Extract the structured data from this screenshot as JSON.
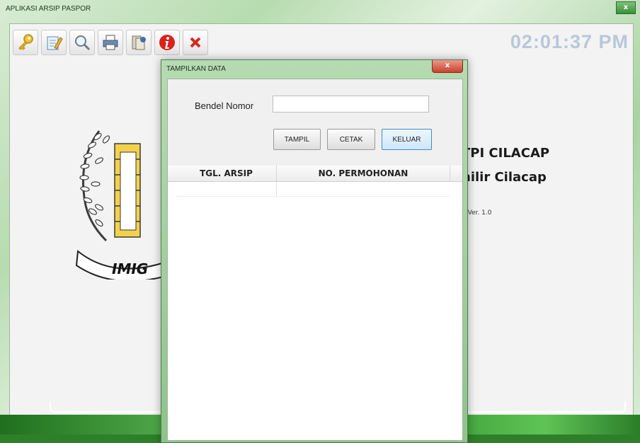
{
  "main_window": {
    "title": "APLIKASI ARSIP PASPOR",
    "close_label": "x",
    "clock": "02:01:37 PM",
    "toolbar_icons": [
      "key-icon",
      "edit-icon",
      "search-icon",
      "print-icon",
      "archive-icon",
      "info-icon",
      "close-icon"
    ],
    "background_text": {
      "line1": "TPI CILACAP",
      "line2": "hilir Cilacap",
      "line3": "n Ver. 1.0",
      "emblem_text": "IMIG"
    }
  },
  "dialog": {
    "title": "TAMPILKAN DATA",
    "close_label": "x",
    "bendel_label": "Bendel Nomor",
    "bendel_value": "",
    "buttons": {
      "tampil": "TAMPIL",
      "cetak": "CETAK",
      "keluar": "KELUAR"
    },
    "table": {
      "columns": [
        "TGL. ARSIP",
        "NO. PERMOHONAN"
      ],
      "rows": []
    }
  },
  "colors": {
    "clock": "#b9c7d9",
    "close_red": "#c9432d",
    "accent_green": "#3b8f38",
    "focus_blue": "#3b8fd1"
  }
}
